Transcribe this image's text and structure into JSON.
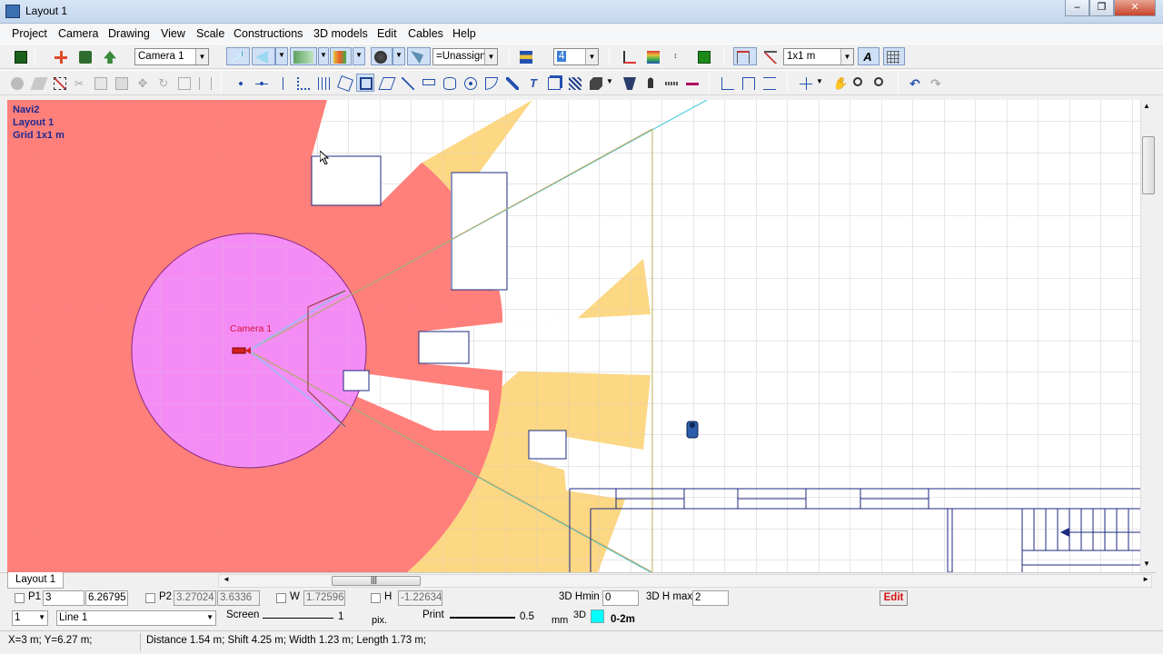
{
  "window": {
    "title": "Layout 1",
    "minimize": "–",
    "maximize": "❐",
    "close": "✕"
  },
  "menu": [
    "Project",
    "Camera",
    "Drawing",
    "View",
    "Scale",
    "Constructions",
    "3D models",
    "Edit",
    "Cables",
    "Help"
  ],
  "toolbar1": {
    "camera_select": "Camera 1",
    "group_select": "=Unassigne",
    "layer_select": "4",
    "grid_select": "1x1 m"
  },
  "canvas": {
    "info_lines": [
      "Navi2",
      "Layout 1",
      "Grid 1x1 m"
    ],
    "camera_label": "Camera 1"
  },
  "layout_tab": "Layout 1",
  "scroll_grip": "|||",
  "props1": {
    "p1_label": "P1",
    "p1_x": "3",
    "p1_y": "6.26795",
    "p2_label": "P2",
    "p2_x": "3.27024",
    "p2_y": "3.6336",
    "w_label": "W",
    "w_value": "1.72596",
    "h_label": "H",
    "h_value": "-1.22634",
    "hmin_label": "3D Hmin",
    "hmin_value": "0",
    "hmax_label": "3D H max",
    "hmax_value": "2",
    "edit_button": "Edit"
  },
  "props2": {
    "number_select": "1",
    "line_select": "Line 1",
    "screen_label": "Screen",
    "screen_value": "1",
    "pix_label": "pix.",
    "print_label": "Print",
    "print_value": "0.5",
    "mm_label": "mm",
    "label_3d": "3D",
    "range_label": "0-2m",
    "accent_color": "#00ffff"
  },
  "status": {
    "coords": "X=3 m; Y=6.27 m;",
    "measure": "Distance 1.54 m; Shift 4.25 m; Width 1.23 m; Length 1.73 m;"
  }
}
